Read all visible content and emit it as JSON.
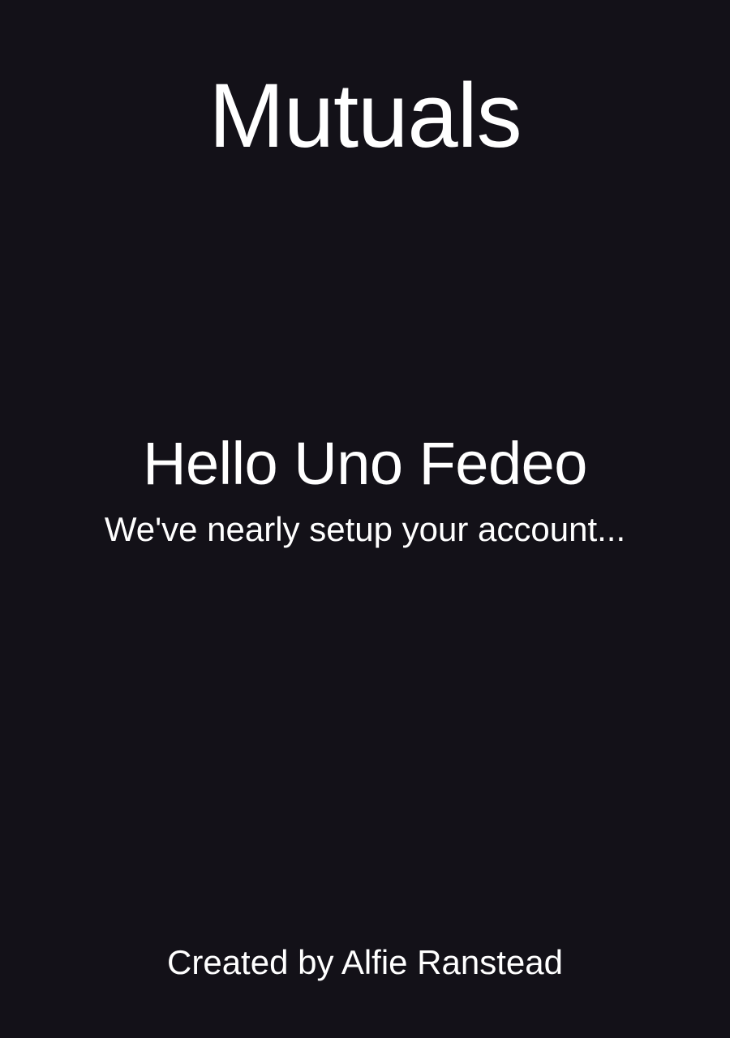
{
  "app": {
    "title": "Mutuals"
  },
  "welcome": {
    "greeting": "Hello Uno Fedeo",
    "status": "We've nearly setup your account..."
  },
  "footer": {
    "credit": "Created by Alfie Ranstead"
  },
  "colors": {
    "background": "#131118",
    "text": "#ffffff"
  }
}
